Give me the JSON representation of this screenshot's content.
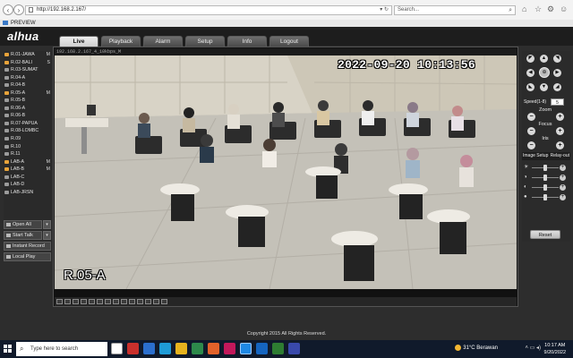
{
  "browser": {
    "url": "http://192.168.2.167/",
    "search_placeholder": "Search...",
    "tab_title": "PREVIEW",
    "back_icon": "back-arrow-icon",
    "forward_icon": "forward-arrow-icon"
  },
  "app": {
    "logo": "alhua",
    "nav": [
      "Live",
      "Playback",
      "Alarm",
      "Setup",
      "Info",
      "Logout"
    ],
    "active_nav": "Live",
    "channels": [
      {
        "label": "R.01-JAWA",
        "live": true,
        "mark": "M"
      },
      {
        "label": "R.02-BALI",
        "live": true,
        "mark": "S"
      },
      {
        "label": "R.03-SUMAT",
        "live": false,
        "mark": ""
      },
      {
        "label": "R.04-A",
        "live": false,
        "mark": ""
      },
      {
        "label": "R.04-B",
        "live": false,
        "mark": ""
      },
      {
        "label": "R.05-A",
        "live": true,
        "mark": "M"
      },
      {
        "label": "R.05-B",
        "live": false,
        "mark": ""
      },
      {
        "label": "R.06-A",
        "live": false,
        "mark": ""
      },
      {
        "label": "R.06-B",
        "live": false,
        "mark": ""
      },
      {
        "label": "R.07-PAPUA",
        "live": false,
        "mark": ""
      },
      {
        "label": "R.08-LOMBC",
        "live": false,
        "mark": ""
      },
      {
        "label": "R.09",
        "live": false,
        "mark": ""
      },
      {
        "label": "R.10",
        "live": false,
        "mark": ""
      },
      {
        "label": "R.11",
        "live": false,
        "mark": ""
      },
      {
        "label": "LAB-A",
        "live": true,
        "mark": "M"
      },
      {
        "label": "LAB-B",
        "live": true,
        "mark": "M"
      },
      {
        "label": "LAB-C",
        "live": false,
        "mark": ""
      },
      {
        "label": "LAB-D",
        "live": false,
        "mark": ""
      },
      {
        "label": "LAB-JRSN",
        "live": false,
        "mark": ""
      }
    ],
    "left_controls": {
      "open_all": "Open All",
      "start_talk": "Start Talk",
      "instant_record": "Instant Record",
      "local_play": "Local Play"
    },
    "video": {
      "stream_info": "192.168.2.167_4_10kbps_M",
      "timestamp": "2022-09-20 10:13:56",
      "room_label": "R.05-A"
    },
    "ptz": {
      "speed_label": "Speed(1-8)",
      "speed_value": "5",
      "zoom_label": "Zoom",
      "focus_label": "Focus",
      "iris_label": "Iris",
      "image_setup_label": "Image Setup",
      "relay_out_label": "Relay-out",
      "reset_label": "Reset",
      "sliders": {
        "brightness": 0.5,
        "contrast": 0.5,
        "saturation": 0.5,
        "hue": 0.5
      }
    },
    "copyright": "Copyright 2015 All Rights Reserved."
  },
  "taskbar": {
    "search_placeholder": "Type here to search",
    "weather": "31°C  Berawan",
    "time": "10:17 AM",
    "date": "9/20/2022",
    "colors": {
      "bg": "#101a2b",
      "accent": "#e8a33a"
    }
  }
}
